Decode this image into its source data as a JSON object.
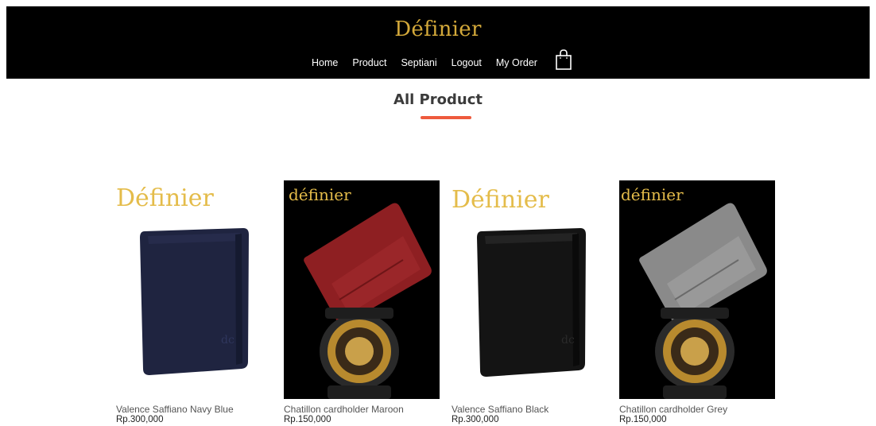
{
  "header": {
    "brand": "Définier",
    "nav": [
      {
        "label": "Home"
      },
      {
        "label": "Product"
      },
      {
        "label": "Septiani"
      },
      {
        "label": "Logout"
      },
      {
        "label": "My Order"
      }
    ],
    "cart_icon": "shopping-bag-icon"
  },
  "main": {
    "title": "All Product",
    "accent_color": "#ee5a3d"
  },
  "products": [
    {
      "name": "Valence Saffiano Navy Blue",
      "price": "Rp.300,000",
      "image_brand": "Définier",
      "color": "#1f2440"
    },
    {
      "name": "Chatillon cardholder Maroon",
      "price": "Rp.150,000",
      "image_brand": "définier",
      "color": "#8e1f22"
    },
    {
      "name": "Valence Saffiano Black",
      "price": "Rp.300,000",
      "image_brand": "Définier",
      "color": "#141414"
    },
    {
      "name": "Chatillon cardholder Grey",
      "price": "Rp.150,000",
      "image_brand": "définier",
      "color": "#8a8a8a"
    }
  ],
  "colors": {
    "header_bg": "#000000",
    "brand_gold": "#d4a93a"
  }
}
